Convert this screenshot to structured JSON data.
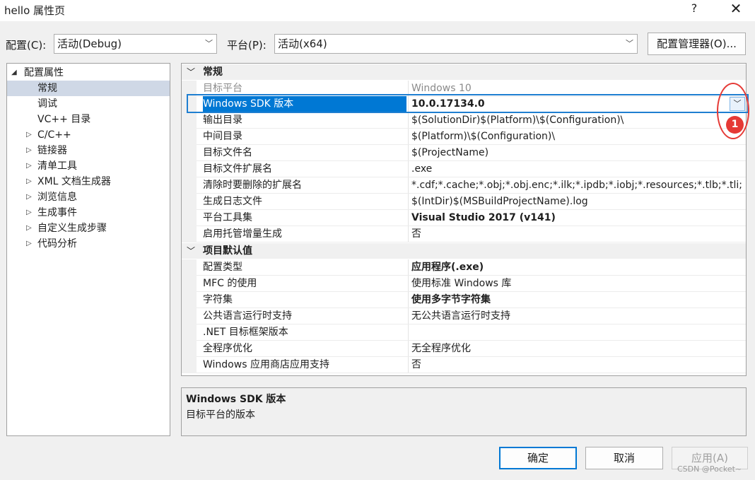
{
  "window": {
    "title": "hello 属性页",
    "help": "?",
    "close": "✕"
  },
  "toolbar": {
    "config_label": "配置(C):",
    "config_value": "活动(Debug)",
    "platform_label": "平台(P):",
    "platform_value": "活动(x64)",
    "config_manager": "配置管理器(O)..."
  },
  "tree": {
    "root": "配置属性",
    "items": [
      "常规",
      "调试",
      "VC++ 目录",
      "C/C++",
      "链接器",
      "清单工具",
      "XML 文档生成器",
      "浏览信息",
      "生成事件",
      "自定义生成步骤",
      "代码分析"
    ]
  },
  "grid": {
    "section1": "常规",
    "section2": "项目默认值",
    "rows": [
      {
        "name": "目标平台",
        "value": "Windows 10"
      },
      {
        "name": "Windows SDK 版本",
        "value": "10.0.17134.0"
      },
      {
        "name": "输出目录",
        "value": "$(SolutionDir)$(Platform)\\$(Configuration)\\"
      },
      {
        "name": "中间目录",
        "value": "$(Platform)\\$(Configuration)\\"
      },
      {
        "name": "目标文件名",
        "value": "$(ProjectName)"
      },
      {
        "name": "目标文件扩展名",
        "value": ".exe"
      },
      {
        "name": "清除时要删除的扩展名",
        "value": "*.cdf;*.cache;*.obj;*.obj.enc;*.ilk;*.ipdb;*.iobj;*.resources;*.tlb;*.tli;"
      },
      {
        "name": "生成日志文件",
        "value": "$(IntDir)$(MSBuildProjectName).log"
      },
      {
        "name": "平台工具集",
        "value": "Visual Studio 2017 (v141)"
      },
      {
        "name": "启用托管增量生成",
        "value": "否"
      },
      {
        "name": "配置类型",
        "value": "应用程序(.exe)"
      },
      {
        "name": "MFC 的使用",
        "value": "使用标准 Windows 库"
      },
      {
        "name": "字符集",
        "value": "使用多字节字符集"
      },
      {
        "name": "公共语言运行时支持",
        "value": "无公共语言运行时支持"
      },
      {
        "name": ".NET 目标框架版本",
        "value": ""
      },
      {
        "name": "全程序优化",
        "value": "无全程序优化"
      },
      {
        "name": "Windows 应用商店应用支持",
        "value": "否"
      }
    ]
  },
  "annotation": {
    "badge": "1",
    "color": "#e53935"
  },
  "description": {
    "title": "Windows SDK 版本",
    "text": "目标平台的版本"
  },
  "buttons": {
    "ok": "确定",
    "cancel": "取消",
    "apply": "应用(A)"
  },
  "watermark": "CSDN @Pocket~"
}
